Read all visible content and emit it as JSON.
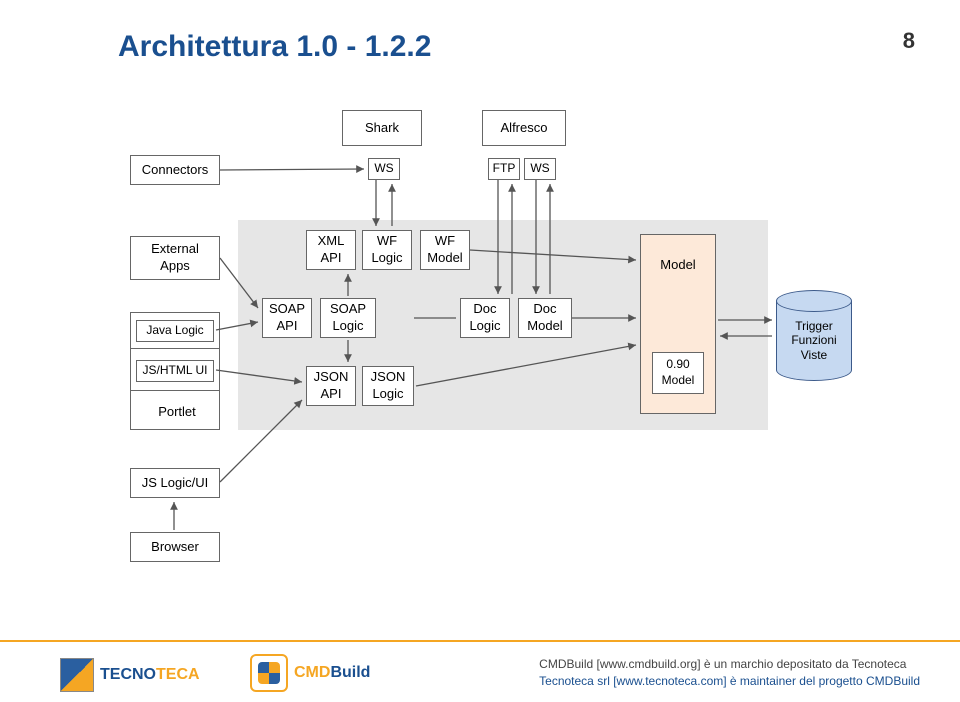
{
  "title": "Architettura 1.0 - 1.2.2",
  "page_number": "8",
  "top_row": {
    "shark": "Shark",
    "alfresco": "Alfresco"
  },
  "left_column": {
    "connectors": "Connectors",
    "external_apps": "External\nApps",
    "java_logic": "Java Logic",
    "js_html_ui": "JS/HTML UI",
    "portlet": "Portlet",
    "js_logic_ui": "JS Logic/UI",
    "browser": "Browser"
  },
  "protocol_labels": {
    "ws1": "WS",
    "ftp": "FTP",
    "ws2": "WS"
  },
  "api_row": {
    "xml_api": "XML\nAPI",
    "wf_logic": "WF\nLogic",
    "wf_model": "WF\nModel",
    "soap_api": "SOAP\nAPI",
    "soap_logic": "SOAP\nLogic",
    "doc_logic": "Doc\nLogic",
    "doc_model": "Doc\nModel",
    "json_api": "JSON\nAPI",
    "json_logic": "JSON\nLogic"
  },
  "model_box": {
    "model": "Model",
    "sub_model": "0.90\nModel"
  },
  "db": "Trigger\nFunzioni\nViste",
  "footer": {
    "line1": "CMDBuild [www.cmdbuild.org] è un marchio depositato da Tecnoteca",
    "line2": "Tecnoteca srl [www.tecnoteca.com] è maintainer del progetto CMDBuild"
  },
  "logos": {
    "tecnoteca_part1": "TECNO",
    "tecnoteca_part2": "TECA",
    "cmdbuild_part1": "CMD",
    "cmdbuild_part2": "Build"
  },
  "colors": {
    "title_blue": "#1a4f8f",
    "accent_orange": "#f5a623",
    "panel_grey": "#e6e6e6",
    "model_peach": "#fde9d9",
    "db_blue": "#c6d9f1"
  }
}
